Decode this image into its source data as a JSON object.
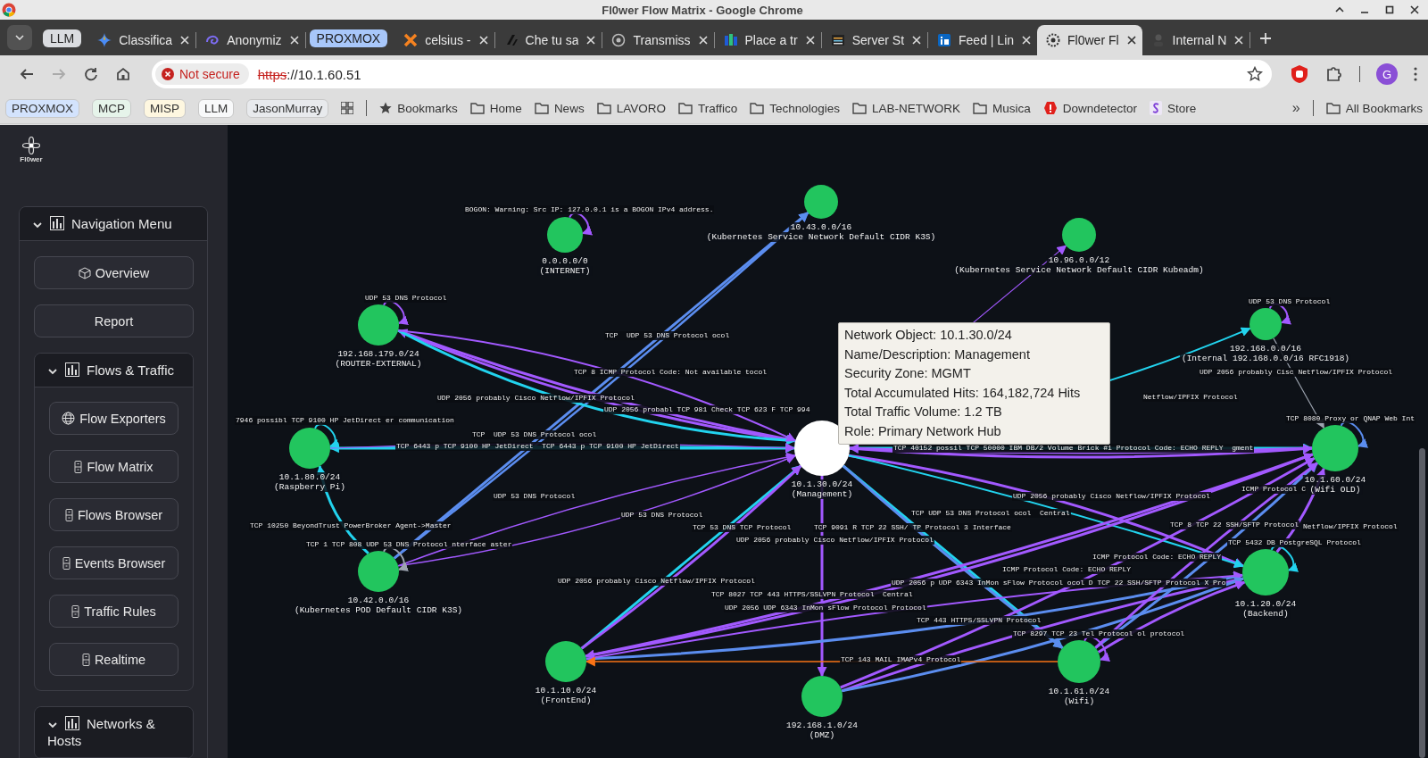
{
  "window": {
    "title": "Fl0wer Flow Matrix - Google Chrome"
  },
  "tab_strip": [
    {
      "kind": "group",
      "label": "LLM",
      "color": "#dadce0"
    },
    {
      "kind": "tab",
      "label": "Classifica",
      "selected": false
    },
    {
      "kind": "tab",
      "label": "Anonymiz",
      "selected": false
    },
    {
      "kind": "group",
      "label": "PROXMOX",
      "color": "#a8c7fa"
    },
    {
      "kind": "tab",
      "label": "celsius -",
      "selected": false
    },
    {
      "kind": "tab",
      "label": "Che tu sa",
      "selected": false
    },
    {
      "kind": "tab",
      "label": "Transmiss",
      "selected": false
    },
    {
      "kind": "tab",
      "label": "Place a tr",
      "selected": false
    },
    {
      "kind": "tab",
      "label": "Server St",
      "selected": false
    },
    {
      "kind": "tab",
      "label": "Feed | Lin",
      "selected": false
    },
    {
      "kind": "tab",
      "label": "Fl0wer Fl",
      "selected": true
    },
    {
      "kind": "tab",
      "label": "Internal N",
      "selected": false
    }
  ],
  "address_bar": {
    "security": "Not secure",
    "scheme": "https",
    "rest": "://10.1.60.51",
    "profile_initial": "G"
  },
  "bookmarks": [
    {
      "kind": "group",
      "label": "PROXMOX",
      "color": "#d3e3fd"
    },
    {
      "kind": "group",
      "label": "MCP",
      "color": "#e6f4ea"
    },
    {
      "kind": "group",
      "label": "MISP",
      "color": "#fef7e0"
    },
    {
      "kind": "group",
      "label": "LLM",
      "color": "#f8f9fa"
    },
    {
      "kind": "group",
      "label": "JasonMurray",
      "color": "#e8eaed"
    },
    {
      "kind": "star",
      "label": "Bookmarks"
    },
    {
      "kind": "folder",
      "label": "Home"
    },
    {
      "kind": "folder",
      "label": "News"
    },
    {
      "kind": "folder",
      "label": "LAVORO"
    },
    {
      "kind": "folder",
      "label": "Traffico"
    },
    {
      "kind": "folder",
      "label": "Technologies"
    },
    {
      "kind": "folder",
      "label": "LAB-NETWORK"
    },
    {
      "kind": "folder",
      "label": "Musica"
    },
    {
      "kind": "site",
      "label": "Downdetector"
    },
    {
      "kind": "site",
      "label": "Store"
    }
  ],
  "bookmarks_overflow": "»",
  "all_bookmarks": "All Bookmarks",
  "sidebar": {
    "logo_text": "Fl0wer",
    "sections": [
      {
        "title": "Navigation Menu",
        "expanded": true,
        "items": [
          {
            "kind": "link",
            "label": "Overview"
          },
          {
            "kind": "link",
            "label": "Report"
          },
          {
            "kind": "section",
            "title": "Flows & Traffic",
            "expanded": true,
            "items": [
              {
                "kind": "link",
                "label": "Flow Exporters"
              },
              {
                "kind": "link",
                "label": "Flow Matrix"
              },
              {
                "kind": "link",
                "label": "Flows Browser"
              },
              {
                "kind": "link",
                "label": "Events Browser"
              },
              {
                "kind": "link",
                "label": "Traffic Rules"
              },
              {
                "kind": "link",
                "label": "Realtime"
              }
            ]
          },
          {
            "kind": "section",
            "title": "Networks & Hosts",
            "expanded": true
          }
        ]
      }
    ]
  },
  "graph": {
    "nodes": [
      {
        "address": "0.0.0.0/0",
        "name": "(INTERNET)",
        "selected": false
      },
      {
        "address": "10.43.0.0/16",
        "name": "(Kubernetes Service Network Default CIDR K3S)",
        "selected": false
      },
      {
        "address": "10.96.0.0/12",
        "name": "(Kubernetes Service Network Default CIDR Kubeadm)",
        "selected": false
      },
      {
        "address": "192.168.179.0/24",
        "name": "(ROUTER-EXTERNAL)",
        "selected": false
      },
      {
        "address": "192.168.0.0/16",
        "name": "(Internal 192.168.0.0/16 RFC1918)",
        "selected": false
      },
      {
        "address": "10.1.80.0/24",
        "name": "(Raspberry Pi)",
        "selected": false
      },
      {
        "address": "10.1.30.0/24",
        "name": "(Management)",
        "selected": true
      },
      {
        "address": "10.1.60.0/24",
        "name": "(Wifi OLD)",
        "selected": false
      },
      {
        "address": "10.42.0.0/16",
        "name": "(Kubernetes POD Default CIDR K3S)",
        "selected": false
      },
      {
        "address": "10.1.20.0/24",
        "name": "(Backend)",
        "selected": false
      },
      {
        "address": "10.1.10.0/24",
        "name": "(FrontEnd)",
        "selected": false
      },
      {
        "address": "192.168.1.0/24",
        "name": "(DMZ)",
        "selected": false
      },
      {
        "address": "10.1.61.0/24",
        "name": "(Wifi)",
        "selected": false
      }
    ],
    "edge_labels": [
      "BOGON: Warning: Src IP: 127.0.0.1 is a BOGON IPv4 address.",
      "UDP 53 DNS Protocol",
      "TCP  UDP 53 DNS Protocol ocol",
      "TCP 8 ICMP Protocol Code: Not available tocol",
      "UDP 2056 probably Cisco Netflow/IPFIX Protocol",
      "UDP 2056 probabl TCP 981 Check TCP 623 F TCP 994",
      "7946 possibl TCP 9100 HP JetDirect er communication",
      "TCP  UDP 53 DNS Protocol ocol",
      "TCP 6443 p TCP 9100 HP JetDirect  TCP 6443 p TCP 9100 HP JetDirect",
      "UDP 53 DNS Protocol",
      "TCP 10250 BeyondTrust PowerBroker Agent->Master",
      "UDP 53 DNS Protocol",
      "TCP 1 TCP 808 UDP 53 DNS Protocol nterface aster",
      "TCP 53 DNS TCP Protocol",
      "TCP 9091 R TCP 22 SSH/ TP Protocol 3 Interface",
      "TCP UDP 53 DNS Protocol ocol  Central",
      "UDP 2056 probably Cisco Netflow/IPFIX Protocol",
      "UDP 2056 probably Cisco Netflow/IPFIX Protocol",
      "TCP 8 TCP 22 SSH/SFTP Protocol",
      "Netflow/IPFIX Protocol",
      "TCP 5432 DB PostgreSQL Protocol",
      "ICMP Protocol Code: ECHO REPLY",
      "ICMP Protocol Code: ECHO REPLY",
      "UDP 2056 probably Cisco Netflow/IPFIX Protocol",
      "UDP 2056 p UDP 6343 InMon sFlow Protocol ocol D TCP 22 SSH/SFTP Protocol X Pro",
      "TCP 8027 TCP 443 HTTPS/SSLVPN Protocol  Central",
      "UDP 2056 UDP 6343 InMon sFlow Protocol Protocol",
      "TCP 443 HTTPS/SSLVPN Protocol",
      "TCP 8297 TCP 23 Tel Protocol ol protocol",
      "TCP 143 MAIL IMAPv4 Protocol",
      "UDP 53 DNS Protocol",
      "UDP 2056 probably Cisc Netflow/IPFIX Protocol",
      "Netflow/IPFIX Protocol",
      "TCP 40152 possil TCP 50000 IBM DB/2 Volume Brick #1 Protocol Code: ECHO REPLY  gment",
      "TCP 8080 Proxy or QNAP Web Int",
      "ICMP Protocol C"
    ],
    "tooltip": {
      "lines": [
        "Network Object: 10.1.30.0/24",
        "Name/Description: Management",
        "Security Zone: MGMT",
        "Total Accumulated Hits: 164,182,724 Hits",
        "Total Traffic Volume: 1.2 TB",
        "Role: Primary Network Hub"
      ]
    }
  }
}
